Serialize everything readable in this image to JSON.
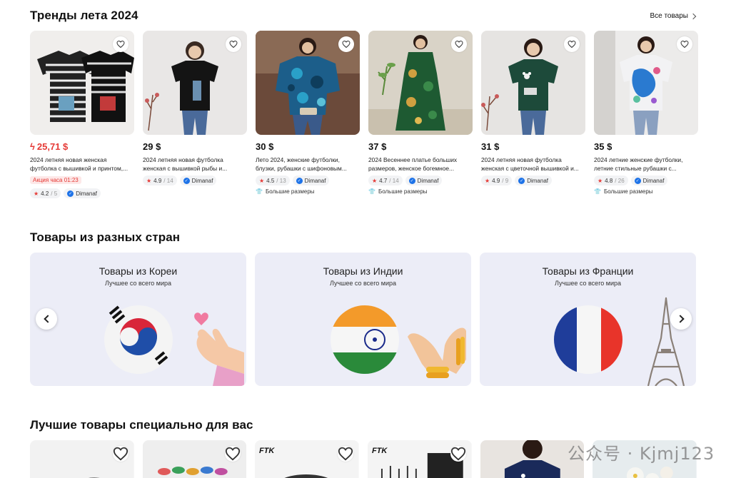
{
  "sections": {
    "trends_title": "Тренды лета 2024",
    "see_all": "Все товары",
    "countries_title": "Товары из разных стран",
    "best_title": "Лучшие товары специально для вас"
  },
  "products": [
    {
      "price": "25,71 $",
      "sale": true,
      "desc": "2024 летняя новая женская футболка с вышивкой и принтом,...",
      "promo": "Акция часа 01:23",
      "rating": "4.2",
      "reviews": "/ 5",
      "seller": "Dimanaf",
      "tag": ""
    },
    {
      "price": "29 $",
      "sale": false,
      "desc": "2024 летняя новая футболка женская с вышивкой рыбы и...",
      "promo": "",
      "rating": "4.9",
      "reviews": "/ 14",
      "seller": "Dimanaf",
      "tag": ""
    },
    {
      "price": "30 $",
      "sale": false,
      "desc": "Лето 2024, женские футболки, блузки, рубашки с шифоновым...",
      "promo": "",
      "rating": "4.5",
      "reviews": "/ 13",
      "seller": "Dimanaf",
      "tag": "Большие размеры"
    },
    {
      "price": "37 $",
      "sale": false,
      "desc": "2024 Весеннее платье больших размеров, женское богемное...",
      "promo": "",
      "rating": "4.7",
      "reviews": "/ 14",
      "seller": "Dimanaf",
      "tag": "Большие размеры"
    },
    {
      "price": "31 $",
      "sale": false,
      "desc": "2024 летняя новая футболка женская с цветочной вышивкой и...",
      "promo": "",
      "rating": "4.9",
      "reviews": "/ 9",
      "seller": "Dimanaf",
      "tag": ""
    },
    {
      "price": "35 $",
      "sale": false,
      "desc": "2024 летние женские футболки, летние стильные рубашки с...",
      "promo": "",
      "rating": "4.8",
      "reviews": "/ 26",
      "seller": "Dimanaf",
      "tag": "Большие размеры"
    }
  ],
  "countries": [
    {
      "title": "Товары из Кореи",
      "subtitle": "Лучшее со всего мира"
    },
    {
      "title": "Товары из Индии",
      "subtitle": "Лучшее со всего мира"
    },
    {
      "title": "Товары из Франции",
      "subtitle": "Лучшее со всего мира"
    }
  ],
  "bottom_brands": [
    "",
    "",
    "FTK",
    "FTK",
    "",
    ""
  ],
  "watermark": "公众号 · Kjmj123",
  "colors": {
    "sale": "#e53935",
    "verified": "#1e73e8",
    "country_bg": "#ecedf7"
  }
}
